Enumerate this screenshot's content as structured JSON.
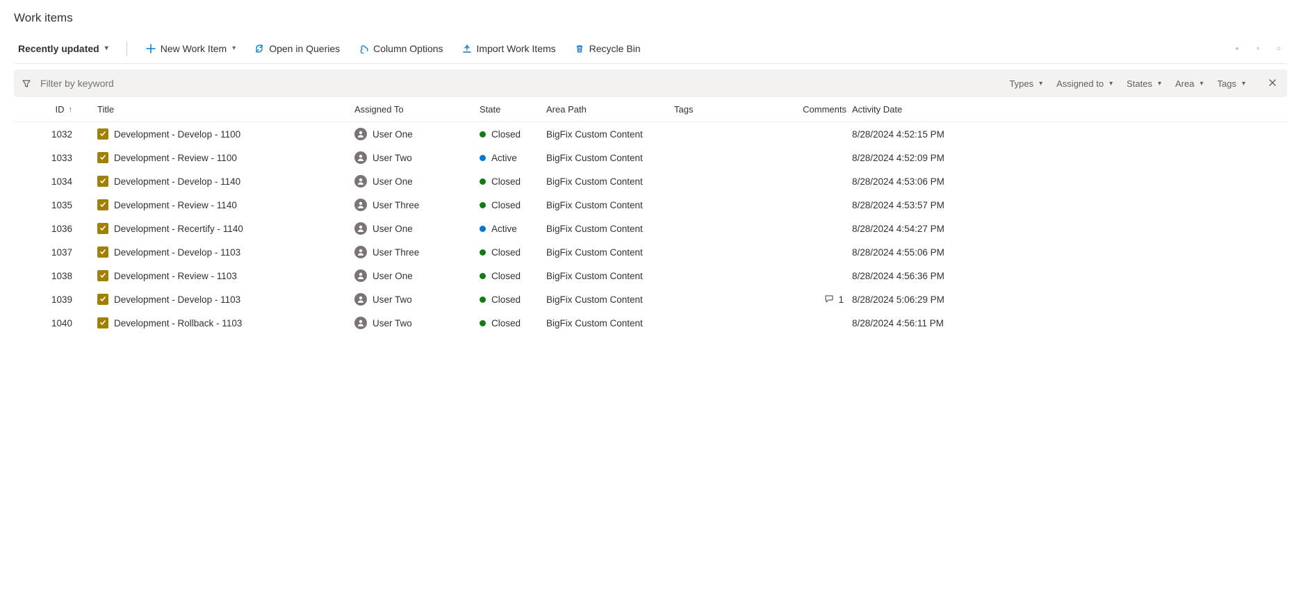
{
  "header": {
    "title": "Work items"
  },
  "toolbar": {
    "view_label": "Recently updated",
    "new_work_item": "New Work Item",
    "open_in_queries": "Open in Queries",
    "column_options": "Column Options",
    "import": "Import Work Items",
    "recycle_bin": "Recycle Bin"
  },
  "filter": {
    "placeholder": "Filter by keyword",
    "pills": {
      "types": "Types",
      "assigned_to": "Assigned to",
      "states": "States",
      "area": "Area",
      "tags": "Tags"
    }
  },
  "columns": {
    "id": "ID",
    "title": "Title",
    "assigned_to": "Assigned To",
    "state": "State",
    "area_path": "Area Path",
    "tags": "Tags",
    "comments": "Comments",
    "activity_date": "Activity Date"
  },
  "rows": [
    {
      "id": "1032",
      "title": "Development - Develop - 1100",
      "assigned": "User One",
      "state": "Closed",
      "area": "BigFix Custom Content",
      "comments": "",
      "date": "8/28/2024 4:52:15 PM"
    },
    {
      "id": "1033",
      "title": "Development - Review - 1100",
      "assigned": "User Two",
      "state": "Active",
      "area": "BigFix Custom Content",
      "comments": "",
      "date": "8/28/2024 4:52:09 PM"
    },
    {
      "id": "1034",
      "title": "Development - Develop - 1140",
      "assigned": "User One",
      "state": "Closed",
      "area": "BigFix Custom Content",
      "comments": "",
      "date": "8/28/2024 4:53:06 PM"
    },
    {
      "id": "1035",
      "title": "Development - Review - 1140",
      "assigned": "User Three",
      "state": "Closed",
      "area": "BigFix Custom Content",
      "comments": "",
      "date": "8/28/2024 4:53:57 PM"
    },
    {
      "id": "1036",
      "title": "Development - Recertify - 1140",
      "assigned": "User One",
      "state": "Active",
      "area": "BigFix Custom Content",
      "comments": "",
      "date": "8/28/2024 4:54:27 PM"
    },
    {
      "id": "1037",
      "title": "Development - Develop - 1103",
      "assigned": "User Three",
      "state": "Closed",
      "area": "BigFix Custom Content",
      "comments": "",
      "date": "8/28/2024 4:55:06 PM"
    },
    {
      "id": "1038",
      "title": "Development - Review - 1103",
      "assigned": "User One",
      "state": "Closed",
      "area": "BigFix Custom Content",
      "comments": "",
      "date": "8/28/2024 4:56:36 PM"
    },
    {
      "id": "1039",
      "title": "Development - Develop - 1103",
      "assigned": "User Two",
      "state": "Closed",
      "area": "BigFix Custom Content",
      "comments": "1",
      "date": "8/28/2024 5:06:29 PM"
    },
    {
      "id": "1040",
      "title": "Development - Rollback - 1103",
      "assigned": "User Two",
      "state": "Closed",
      "area": "BigFix Custom Content",
      "comments": "",
      "date": "8/28/2024 4:56:11 PM"
    }
  ]
}
